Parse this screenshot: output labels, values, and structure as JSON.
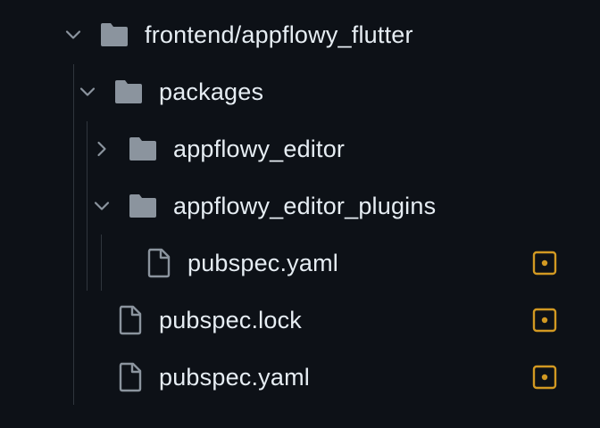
{
  "colors": {
    "background": "#0d1117",
    "text": "#e6edf3",
    "icon": "#8b949e",
    "chevron": "#8b949e",
    "guide": "#30363d",
    "modified_badge": "#d29922"
  },
  "tree": {
    "root": {
      "label": "frontend/appflowy_flutter",
      "type": "folder",
      "expanded": true,
      "icon": "folder-icon",
      "chevron": "chevron-down-icon"
    },
    "packages": {
      "label": "packages",
      "type": "folder",
      "expanded": true,
      "icon": "folder-icon",
      "chevron": "chevron-down-icon"
    },
    "appflowy_editor": {
      "label": "appflowy_editor",
      "type": "folder",
      "expanded": false,
      "icon": "folder-icon",
      "chevron": "chevron-right-icon"
    },
    "appflowy_editor_plugins": {
      "label": "appflowy_editor_plugins",
      "type": "folder",
      "expanded": true,
      "icon": "folder-icon",
      "chevron": "chevron-down-icon"
    },
    "plugins_pubspec_yaml": {
      "label": "pubspec.yaml",
      "type": "file",
      "icon": "file-icon",
      "status_icon": "modified-dot-icon"
    },
    "pubspec_lock": {
      "label": "pubspec.lock",
      "type": "file",
      "icon": "file-icon",
      "status_icon": "modified-dot-icon"
    },
    "pubspec_yaml": {
      "label": "pubspec.yaml",
      "type": "file",
      "icon": "file-icon",
      "status_icon": "modified-dot-icon"
    }
  }
}
